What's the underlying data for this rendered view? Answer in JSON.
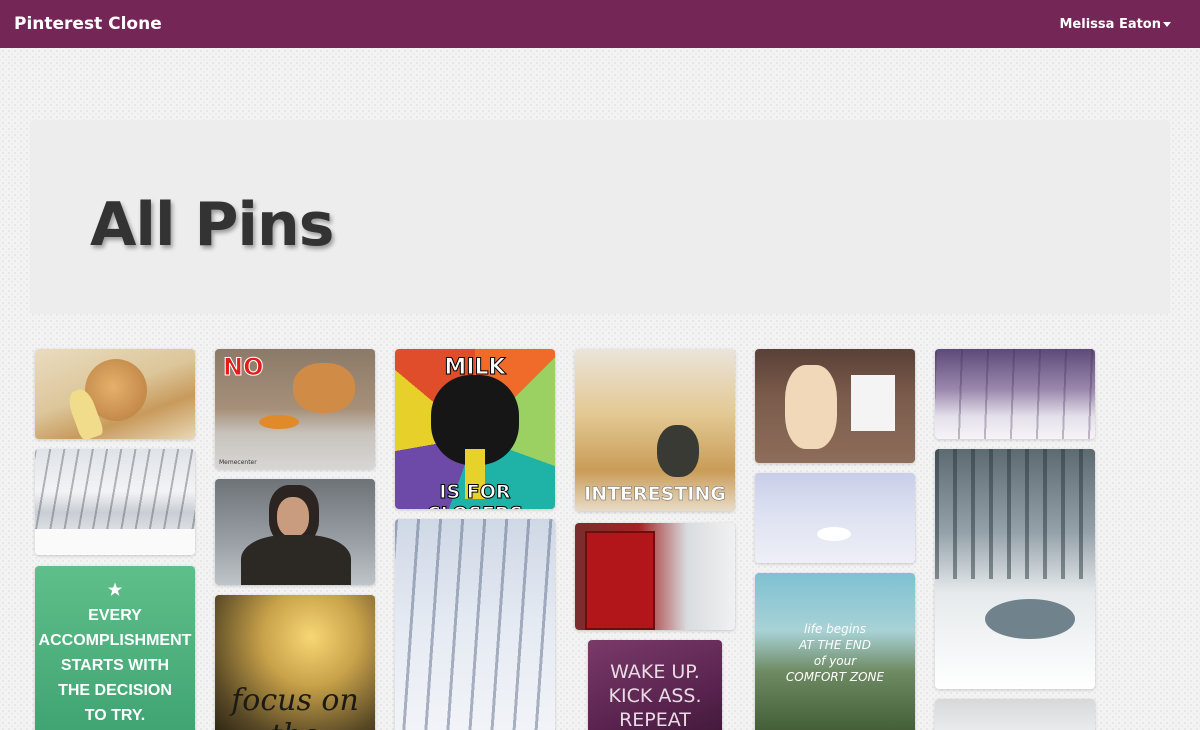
{
  "navbar": {
    "brand": "Pinterest Clone",
    "user_name": "Melissa Eaton"
  },
  "header": {
    "title": "All Pins"
  },
  "pins": {
    "p1": {
      "subject": "cat with banana"
    },
    "p2": {
      "subject": "cat eating pie",
      "text": "NO",
      "watermark": "Meme​center"
    },
    "p3": {
      "subject": "business cat meme",
      "top_text": "MILK",
      "bottom_text": "IS FOR CLOSERS"
    },
    "p4": {
      "subject": "cat on leather couch",
      "text": "INTERESTING"
    },
    "p5": {
      "subject": "two cats on sofa"
    },
    "p6": {
      "subject": "snowy purple forest"
    },
    "p7": {
      "subject": "snowy tree lined road"
    },
    "p8": {
      "subject": "man in fur cloak"
    },
    "p9": {
      "subject": "snowy birch forest"
    },
    "p10": {
      "subject": "red telephone box in snow"
    },
    "p11": {
      "subject": "snowman in snow"
    },
    "p12": {
      "subject": "snowy river forest"
    },
    "p13": {
      "subject": "quote card",
      "text": "★\nEVERY\nACCOMPLISHMENT\nSTARTS WITH\nTHE DECISION\nTO TRY."
    },
    "p14": {
      "subject": "bokeh flowers",
      "text": "focus on the"
    },
    "p15": {
      "subject": "purple sign",
      "text": "WAKE UP.\nKICK ASS.\nREPEAT"
    },
    "p16": {
      "subject": "mountain valley",
      "text": "life begins\nAT THE END\nof your\nCOMFORT ZONE"
    },
    "p17": {
      "subject": "snowy scene"
    }
  },
  "colors": {
    "navbar": "#742756",
    "jumbotron": "#ededed",
    "title": "#333333"
  }
}
